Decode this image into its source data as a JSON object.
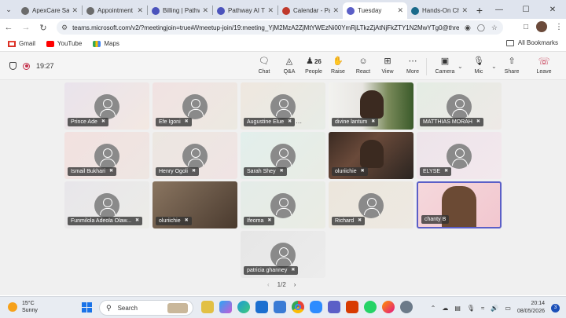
{
  "browser": {
    "tabs": [
      {
        "title": "ApexCare Sal",
        "favicon_color": "#6b6b6b"
      },
      {
        "title": "Appointment",
        "favicon_color": "#6b6b6b"
      },
      {
        "title": "Billing | Pathw",
        "favicon_color": "#4b53bc"
      },
      {
        "title": "Pathway AI Tr",
        "favicon_color": "#4b53bc"
      },
      {
        "title": "Calendar - Pat",
        "favicon_color": "#c0392b"
      },
      {
        "title": "Tuesday",
        "favicon_color": "#5b5fc7",
        "active": true
      },
      {
        "title": "Hands-On Ch",
        "favicon_color": "#1a6a8a"
      }
    ],
    "url": "teams.microsoft.com/v2/?meetingjoin=true#/l/meetup-join/19:meeting_YjM2MzA2ZjMtYWEzNi00YmRjLTkzZjAtNjFkZTY1N2MwYTg0@thre...",
    "bookmarks": [
      {
        "label": "Gmail",
        "icon": "gmail-icon"
      },
      {
        "label": "YouTube",
        "icon": "youtube-icon"
      },
      {
        "label": "Maps",
        "icon": "maps-icon"
      }
    ],
    "all_bookmarks": "All Bookmarks"
  },
  "meeting": {
    "timer": "19:27",
    "controls": {
      "chat": "Chat",
      "qa": "Q&A",
      "people": "People",
      "people_count": "26",
      "raise": "Raise",
      "react": "React",
      "view": "View",
      "more": "More",
      "camera": "Camera",
      "mic": "Mic",
      "share": "Share",
      "leave": "Leave"
    },
    "participants": [
      {
        "name": "Prince Ade",
        "video": false
      },
      {
        "name": "Efe Igoni",
        "video": false
      },
      {
        "name": "Augustine Elue",
        "video": false
      },
      {
        "name": "divine lantum",
        "video": true
      },
      {
        "name": "MATTHIAS MORAH",
        "video": false
      },
      {
        "name": "Ismail Bukhari",
        "video": false
      },
      {
        "name": "Henry Ogoli",
        "video": false
      },
      {
        "name": "Sarah Shey",
        "video": false
      },
      {
        "name": "oluriichie",
        "video": true
      },
      {
        "name": "ELYSE",
        "video": false
      },
      {
        "name": "Funmilola Adeola Olaw...",
        "video": false
      },
      {
        "name": "oluriichie",
        "video": true
      },
      {
        "name": "Ifeoma",
        "video": false
      },
      {
        "name": "Richard",
        "video": false
      },
      {
        "name": "chanty B",
        "video": true
      },
      {
        "name": "patricia ghanney",
        "video": false
      }
    ],
    "page_indicator": "1/2"
  },
  "taskbar": {
    "weather_temp": "15°C",
    "weather_desc": "Sunny",
    "search_placeholder": "Search",
    "time": "20:14",
    "date": "08/05/2026",
    "notification_count": "3"
  }
}
